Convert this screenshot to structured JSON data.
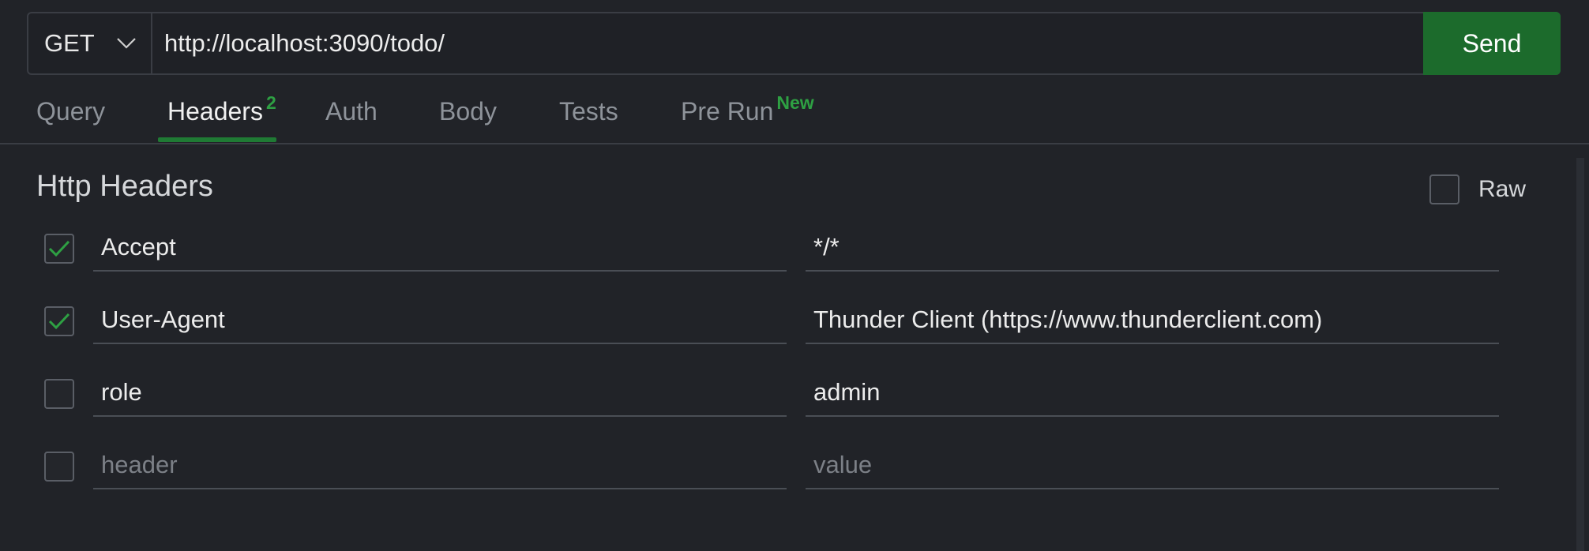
{
  "request": {
    "method": "GET",
    "url": "http://localhost:3090/todo/",
    "send_label": "Send"
  },
  "tabs": [
    {
      "label": "Query",
      "badge": ""
    },
    {
      "label": "Headers",
      "badge": "2"
    },
    {
      "label": "Auth",
      "badge": ""
    },
    {
      "label": "Body",
      "badge": ""
    },
    {
      "label": "Tests",
      "badge": ""
    },
    {
      "label": "Pre Run",
      "badge": "New"
    }
  ],
  "active_tab": "Headers",
  "headers_panel": {
    "title": "Http Headers",
    "raw_label": "Raw",
    "raw_checked": false,
    "rows": [
      {
        "key": "Accept",
        "value": "*/*",
        "checked": true
      },
      {
        "key": "User-Agent",
        "value": "Thunder Client (https://www.thunderclient.com)",
        "checked": true
      },
      {
        "key": "role",
        "value": "admin",
        "checked": false
      }
    ],
    "new_row": {
      "key_placeholder": "header",
      "value_placeholder": "value",
      "checked": false
    }
  },
  "colors": {
    "background": "#212328",
    "accent_green": "#1c6b2c",
    "badge_green": "#2ea043",
    "check_green": "#2ea043"
  }
}
